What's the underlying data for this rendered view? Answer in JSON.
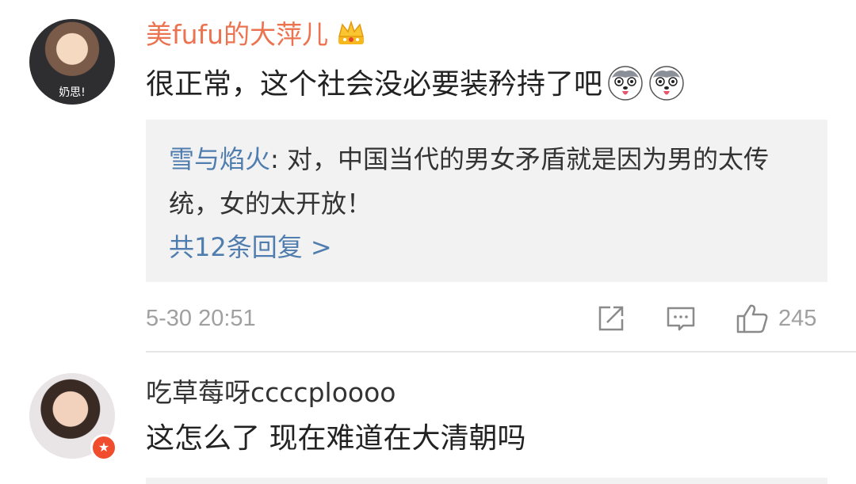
{
  "comments": [
    {
      "avatar_caption": "奶思!",
      "username": "美fufu的大萍儿",
      "badge_icon": "crown-icon",
      "content": "很正常，这个社会没必要装矜持了吧",
      "emojis": [
        "husky-emoji-icon",
        "husky-emoji-icon"
      ],
      "reply_preview": {
        "author": "雪与焰火",
        "separator": ": ",
        "text": "对，中国当代的男女矛盾就是因为男的太传统，女的太开放！",
        "more_label": "共12条回复 >"
      },
      "timestamp": "5-30 20:51",
      "actions": {
        "repost_icon": "repost-icon",
        "comment_icon": "comment-icon",
        "like_icon": "thumbs-up-icon",
        "like_count": "245"
      }
    },
    {
      "username": "吃草莓呀ccccploooo",
      "verified_icon": "verified-badge-icon",
      "content": "这怎么了 现在难道在大清朝吗"
    }
  ],
  "colors": {
    "username_highlight": "#eb7350",
    "link_blue": "#507daf",
    "meta_gray": "#a0a0a0",
    "reply_bg": "#f2f2f2",
    "verified_badge": "#f04d2e"
  }
}
